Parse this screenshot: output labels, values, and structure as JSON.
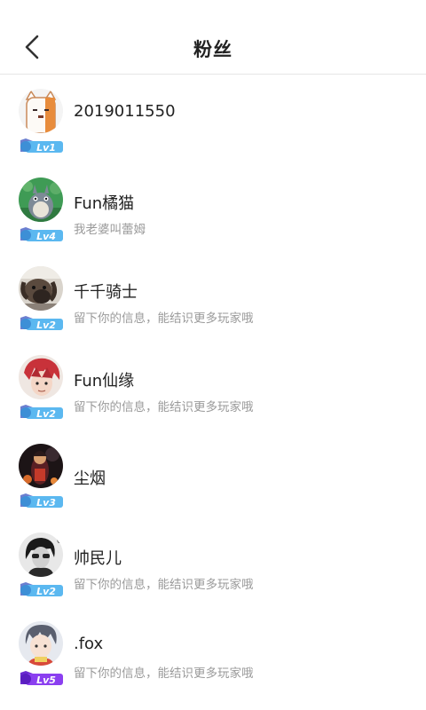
{
  "header": {
    "title": "粉丝",
    "back_icon": "back-arrow-icon"
  },
  "fans": [
    {
      "name": "2019011550",
      "bio": "",
      "level": "Lv1",
      "level_color": "#5bb8f0",
      "avatar": "cartoon-cat-avatar"
    },
    {
      "name": "Fun橘猫",
      "bio": "我老婆叫蕾姆",
      "level": "Lv4",
      "level_color": "#5bb8f0",
      "avatar": "totoro-avatar"
    },
    {
      "name": "千千骑士",
      "bio": "留下你的信息，能结识更多玩家哦",
      "level": "Lv2",
      "level_color": "#5bb8f0",
      "avatar": "dog-photo-avatar"
    },
    {
      "name": "Fun仙缘",
      "bio": "留下你的信息，能结识更多玩家哦",
      "level": "Lv2",
      "level_color": "#5bb8f0",
      "avatar": "anime-redhair-avatar"
    },
    {
      "name": "尘烟",
      "bio": "",
      "level": "Lv3",
      "level_color": "#5bb8f0",
      "avatar": "dark-character-avatar"
    },
    {
      "name": "帅民儿",
      "bio": "留下你的信息，能结识更多玩家哦",
      "level": "Lv2",
      "level_color": "#5bb8f0",
      "avatar": "monochrome-portrait-avatar"
    },
    {
      "name": ".fox",
      "bio": "留下你的信息，能结识更多玩家哦",
      "level": "Lv5",
      "level_color": "#8b3ff0",
      "avatar": "anime-boy-avatar"
    }
  ]
}
